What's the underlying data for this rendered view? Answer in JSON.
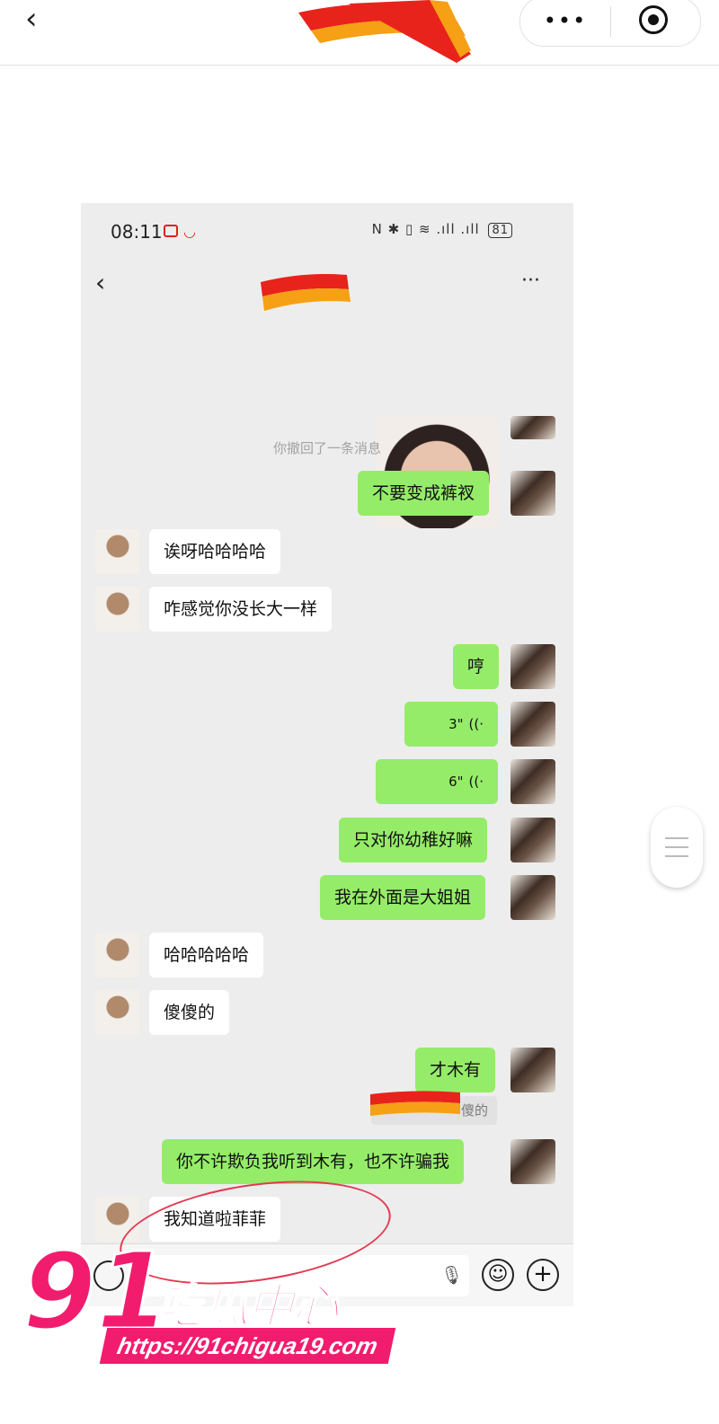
{
  "outer": {
    "back_icon": "chevron-left-icon",
    "more_icon": "more-dots-icon",
    "target_icon": "target-circle-icon"
  },
  "phone": {
    "status": {
      "time": "08:11",
      "icons": "N ✱ ▯ ≋ .ıll .ıll",
      "battery": "81"
    },
    "chat": {
      "back_icon": "chevron-left-icon",
      "more": "···"
    },
    "messages": [
      {
        "from": "me",
        "type": "image"
      },
      {
        "type": "notice",
        "text": "你撤回了一条消息"
      },
      {
        "from": "me",
        "text": "不要变成裤衩"
      },
      {
        "from": "other",
        "text": "诶呀哈哈哈哈"
      },
      {
        "from": "other",
        "text": "咋感觉你没长大一样"
      },
      {
        "from": "me",
        "text": "哼"
      },
      {
        "from": "me",
        "type": "voice",
        "text": "3\""
      },
      {
        "from": "me",
        "type": "voice",
        "text": "6\""
      },
      {
        "from": "me",
        "text": "只对你幼稚好嘛"
      },
      {
        "from": "me",
        "text": "我在外面是大姐姐"
      },
      {
        "from": "other",
        "text": "哈哈哈哈哈"
      },
      {
        "from": "other",
        "text": "傻傻的"
      },
      {
        "from": "me",
        "text": "才木有",
        "quote": "傻的"
      },
      {
        "from": "me",
        "text": "你不许欺负我听到木有，也不许骗我"
      },
      {
        "from": "other",
        "text": "我知道啦菲菲"
      }
    ],
    "input_bar": {
      "voice_icon": "voice-toggle-icon",
      "mic_icon": "microphone-icon",
      "emoji_icon": "emoji-icon",
      "plus_icon": "plus-icon"
    }
  },
  "watermark": {
    "number": "91",
    "name": "吃瓜中心",
    "url": "https://91chigua19.com"
  },
  "colors": {
    "my_bubble": "#95ec69",
    "chat_bg": "#ededed",
    "watermark": "#f21c6e"
  }
}
